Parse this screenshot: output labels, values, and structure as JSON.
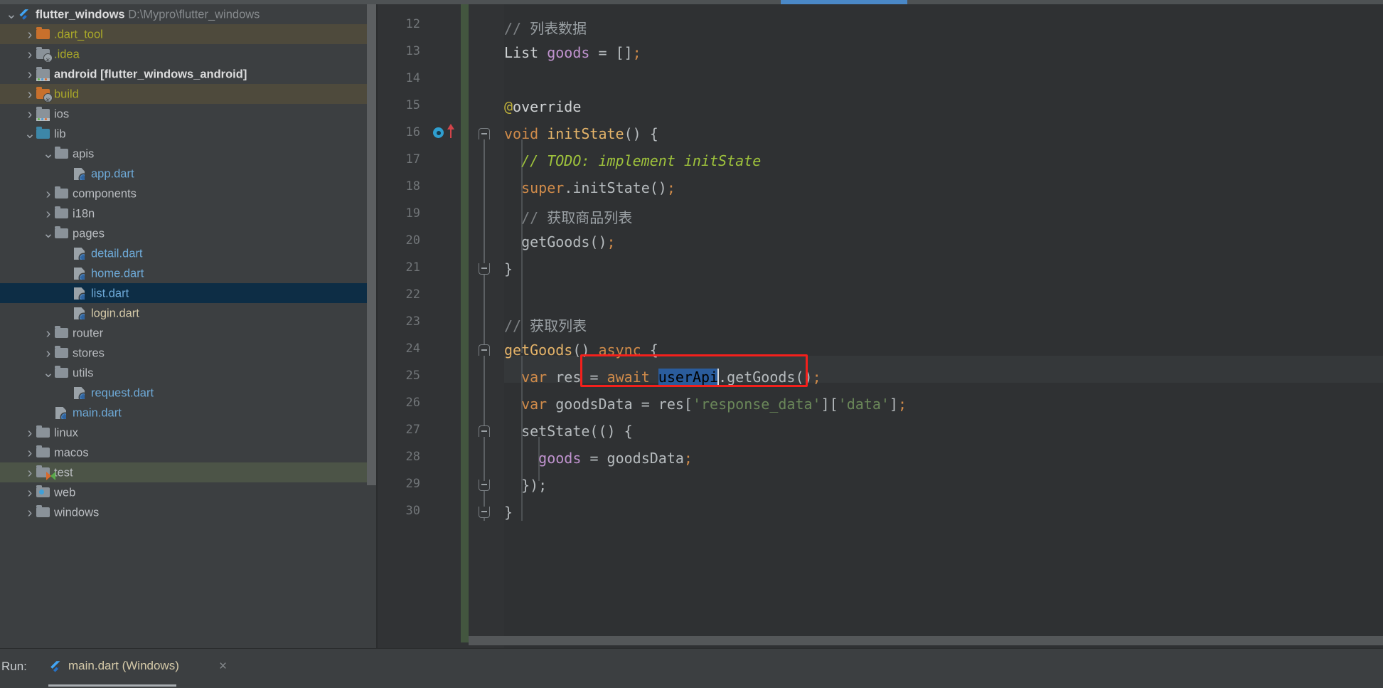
{
  "window": {
    "app": "IntelliJ IDEA / Android Studio"
  },
  "colors": {
    "sidebar_bg": "#3c3f41",
    "editor_bg": "#2f3133",
    "gutter_bg": "#313335",
    "selection_row": "#0d2d45",
    "selection_text": "#2a5c9c",
    "annotation_red": "#f4201c",
    "tab_accent": "#4a88c7",
    "change_bar_green": "#43563f",
    "highlight_build": "#4e4a3c",
    "highlight_test": "#4c5447"
  },
  "project_tree": {
    "root": {
      "name": "flutter_windows",
      "path": "D:\\Mypro\\flutter_windows",
      "icon": "flutter-icon",
      "expanded": true
    },
    "items": [
      {
        "label": ".dart_tool",
        "icon": "folder-orange-icon",
        "depth": 1,
        "arrow": "collapsed",
        "color": "olive",
        "row_highlight": "build"
      },
      {
        "label": ".idea",
        "icon": "folder-module-icon",
        "depth": 1,
        "arrow": "collapsed",
        "color": "olive",
        "row_highlight": "none"
      },
      {
        "label": "android [flutter_windows_android]",
        "icon": "folder-android-icon",
        "depth": 1,
        "arrow": "collapsed",
        "color": "grey-bold",
        "row_highlight": "none"
      },
      {
        "label": "build",
        "icon": "folder-orange-module-icon",
        "depth": 1,
        "arrow": "collapsed",
        "color": "olive",
        "row_highlight": "build"
      },
      {
        "label": "ios",
        "icon": "folder-ios-icon",
        "depth": 1,
        "arrow": "collapsed",
        "color": "grey",
        "row_highlight": "none"
      },
      {
        "label": "lib",
        "icon": "folder-source-icon",
        "depth": 1,
        "arrow": "expanded",
        "color": "grey",
        "row_highlight": "none"
      },
      {
        "label": "apis",
        "icon": "folder-grey-icon",
        "depth": 2,
        "arrow": "expanded",
        "color": "grey",
        "row_highlight": "none"
      },
      {
        "label": "app.dart",
        "icon": "dart-file-icon",
        "depth": 3,
        "arrow": "none",
        "color": "blue",
        "row_highlight": "none"
      },
      {
        "label": "components",
        "icon": "folder-grey-icon",
        "depth": 2,
        "arrow": "collapsed",
        "color": "grey",
        "row_highlight": "none"
      },
      {
        "label": "i18n",
        "icon": "folder-grey-icon",
        "depth": 2,
        "arrow": "collapsed",
        "color": "grey",
        "row_highlight": "none"
      },
      {
        "label": "pages",
        "icon": "folder-grey-icon",
        "depth": 2,
        "arrow": "expanded",
        "color": "grey",
        "row_highlight": "none"
      },
      {
        "label": "detail.dart",
        "icon": "dart-file-icon",
        "depth": 3,
        "arrow": "none",
        "color": "blue",
        "row_highlight": "none"
      },
      {
        "label": "home.dart",
        "icon": "dart-file-icon",
        "depth": 3,
        "arrow": "none",
        "color": "blue",
        "row_highlight": "none"
      },
      {
        "label": "list.dart",
        "icon": "dart-file-icon",
        "depth": 3,
        "arrow": "none",
        "color": "blue",
        "row_highlight": "selected"
      },
      {
        "label": "login.dart",
        "icon": "dart-file-icon",
        "depth": 3,
        "arrow": "none",
        "color": "tan",
        "row_highlight": "none"
      },
      {
        "label": "router",
        "icon": "folder-grey-icon",
        "depth": 2,
        "arrow": "collapsed",
        "color": "grey",
        "row_highlight": "none"
      },
      {
        "label": "stores",
        "icon": "folder-grey-icon",
        "depth": 2,
        "arrow": "collapsed",
        "color": "grey",
        "row_highlight": "none"
      },
      {
        "label": "utils",
        "icon": "folder-grey-icon",
        "depth": 2,
        "arrow": "expanded",
        "color": "grey",
        "row_highlight": "none"
      },
      {
        "label": "request.dart",
        "icon": "dart-file-icon",
        "depth": 3,
        "arrow": "none",
        "color": "blue",
        "row_highlight": "none"
      },
      {
        "label": "main.dart",
        "icon": "dart-file-icon",
        "depth": 2,
        "arrow": "none",
        "color": "blue",
        "row_highlight": "none"
      },
      {
        "label": "linux",
        "icon": "folder-grey-icon",
        "depth": 1,
        "arrow": "collapsed",
        "color": "grey",
        "row_highlight": "none"
      },
      {
        "label": "macos",
        "icon": "folder-grey-icon",
        "depth": 1,
        "arrow": "collapsed",
        "color": "grey",
        "row_highlight": "none"
      },
      {
        "label": "test",
        "icon": "folder-test-icon",
        "depth": 1,
        "arrow": "collapsed",
        "color": "grey",
        "row_highlight": "test"
      },
      {
        "label": "web",
        "icon": "folder-web-icon",
        "depth": 1,
        "arrow": "collapsed",
        "color": "grey",
        "row_highlight": "none"
      },
      {
        "label": "windows",
        "icon": "folder-grey-icon",
        "depth": 1,
        "arrow": "collapsed",
        "color": "grey",
        "row_highlight": "none"
      }
    ]
  },
  "editor": {
    "first_line": 12,
    "last_line": 30,
    "line_numbers": [
      "12",
      "13",
      "14",
      "15",
      "16",
      "17",
      "18",
      "19",
      "20",
      "21",
      "22",
      "23",
      "24",
      "25",
      "26",
      "27",
      "28",
      "29",
      "30"
    ],
    "lines": [
      {
        "n": "12",
        "text": "  // 列表数据"
      },
      {
        "n": "13",
        "text": "  List goods = [];"
      },
      {
        "n": "14",
        "text": ""
      },
      {
        "n": "15",
        "text": "  @override"
      },
      {
        "n": "16",
        "text": "  void initState() {"
      },
      {
        "n": "17",
        "text": "    // TODO: implement initState"
      },
      {
        "n": "18",
        "text": "    super.initState();"
      },
      {
        "n": "19",
        "text": "    // 获取商品列表"
      },
      {
        "n": "20",
        "text": "    getGoods();"
      },
      {
        "n": "21",
        "text": "  }"
      },
      {
        "n": "22",
        "text": ""
      },
      {
        "n": "23",
        "text": "  // 获取列表"
      },
      {
        "n": "24",
        "text": "  getGoods() async {"
      },
      {
        "n": "25",
        "text": "    var res = await userApi.getGoods();"
      },
      {
        "n": "26",
        "text": "    var goodsData = res['response_data']['data'];"
      },
      {
        "n": "27",
        "text": "    setState(() {"
      },
      {
        "n": "28",
        "text": "      goods = goodsData;"
      },
      {
        "n": "29",
        "text": "    });"
      },
      {
        "n": "30",
        "text": "  }"
      }
    ],
    "caret_line": "25",
    "selected_text": "userApi",
    "gutter_icons": {
      "line": "16",
      "breakpoint": "override-method-icon",
      "arrow": "overriding-method-arrow-icon"
    },
    "annotation": {
      "type": "red-rectangle",
      "targets_line": "25"
    }
  },
  "run_panel": {
    "label": "Run:",
    "tab_title": "main.dart (Windows)",
    "tab_icon": "flutter-icon",
    "close_glyph": "×"
  },
  "glyphs": {
    "chevron_right": "›",
    "chevron_down": "⌄",
    "close": "×"
  }
}
